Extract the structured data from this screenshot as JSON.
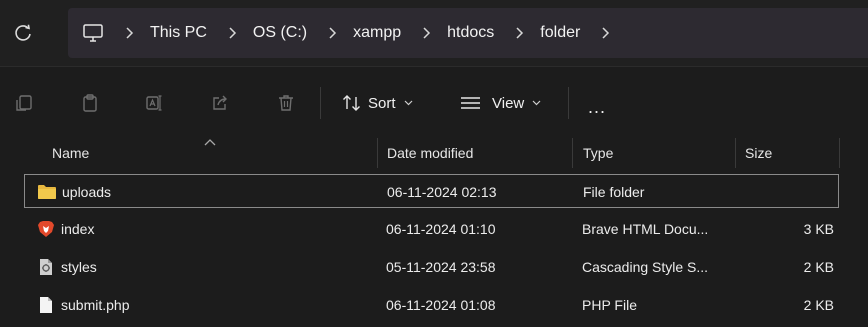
{
  "breadcrumb": {
    "items": [
      {
        "label": "This PC"
      },
      {
        "label": "OS (C:)"
      },
      {
        "label": "xampp"
      },
      {
        "label": "htdocs"
      },
      {
        "label": "folder"
      }
    ]
  },
  "toolbar": {
    "sort_label": "Sort",
    "view_label": "View",
    "more_label": "..."
  },
  "columns": {
    "name": "Name",
    "date": "Date modified",
    "type": "Type",
    "size": "Size"
  },
  "files": [
    {
      "name": "uploads",
      "date": "06-11-2024 02:13",
      "type": "File folder",
      "size": "",
      "icon": "folder-icon"
    },
    {
      "name": "index",
      "date": "06-11-2024 01:10",
      "type": "Brave HTML Docu...",
      "size": "3 KB",
      "icon": "brave-icon"
    },
    {
      "name": "styles",
      "date": "05-11-2024 23:58",
      "type": "Cascading Style S...",
      "size": "2 KB",
      "icon": "css-file-icon"
    },
    {
      "name": "submit.php",
      "date": "06-11-2024 01:08",
      "type": "PHP File",
      "size": "2 KB",
      "icon": "file-icon"
    }
  ],
  "colors": {
    "background": "#1c1c1c",
    "address_bar": "#2d2a31",
    "folder": "#e8b83f",
    "brave": "#e2492b"
  }
}
